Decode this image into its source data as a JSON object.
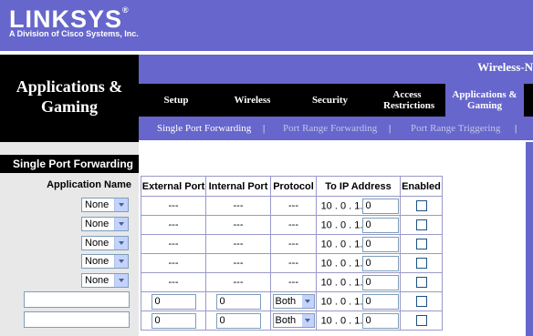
{
  "header": {
    "logo": "LINKSYS",
    "logo_mark": "®",
    "subtitle": "A Division of Cisco Systems, Inc.",
    "model": "Wireless-N"
  },
  "section_title": "Applications & Gaming",
  "tabs": [
    {
      "label": "Setup"
    },
    {
      "label": "Wireless"
    },
    {
      "label": "Security"
    },
    {
      "label": "Access Restrictions"
    },
    {
      "label": "Applications & Gaming",
      "active": true
    }
  ],
  "subnav": {
    "active": "Single Port Forwarding",
    "sep": "|",
    "item2": "Port Range Forwarding",
    "item3": "Port Range Triggering"
  },
  "left": {
    "title": "Single Port Forwarding",
    "app_name_label": "Application Name",
    "selects": [
      "None",
      "None",
      "None",
      "None",
      "None"
    ],
    "custom_inputs": [
      "",
      ""
    ]
  },
  "table": {
    "headers": [
      "External Port",
      "Internal Port",
      "Protocol",
      "To IP Address",
      "Enabled"
    ],
    "ip_prefix": "10 . 0 . 1.",
    "rows": [
      {
        "ext": "---",
        "int": "---",
        "proto": "---",
        "ip_last": "0"
      },
      {
        "ext": "---",
        "int": "---",
        "proto": "---",
        "ip_last": "0"
      },
      {
        "ext": "---",
        "int": "---",
        "proto": "---",
        "ip_last": "0"
      },
      {
        "ext": "---",
        "int": "---",
        "proto": "---",
        "ip_last": "0"
      },
      {
        "ext": "---",
        "int": "---",
        "proto": "---",
        "ip_last": "0"
      },
      {
        "ext": "0",
        "int": "0",
        "proto": "Both",
        "ip_last": "0"
      },
      {
        "ext": "0",
        "int": "0",
        "proto": "Both",
        "ip_last": "0"
      }
    ]
  },
  "colors": {
    "brand_purple": "#6666cc",
    "black": "#000000"
  }
}
